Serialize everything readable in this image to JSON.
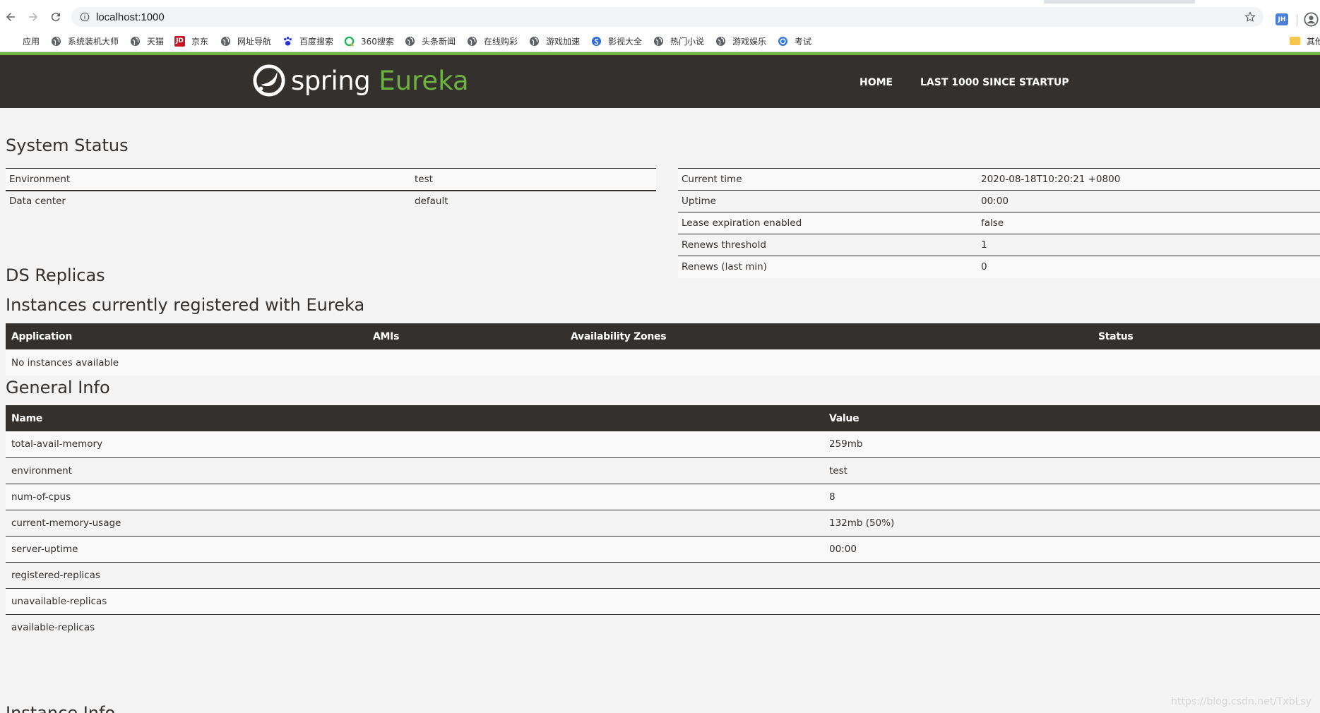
{
  "browser": {
    "url": "localhost:1000",
    "bookmarks": [
      {
        "label": "应用",
        "icon": "apps-grid-icon"
      },
      {
        "label": "系统装机大师",
        "icon": "globe-icon"
      },
      {
        "label": "天猫",
        "icon": "globe-icon"
      },
      {
        "label": "京东",
        "icon": "jd-icon"
      },
      {
        "label": "网址导航",
        "icon": "globe-icon"
      },
      {
        "label": "百度搜索",
        "icon": "baidu-paw-icon"
      },
      {
        "label": "360搜索",
        "icon": "360-search-icon"
      },
      {
        "label": "头条新闻",
        "icon": "globe-icon"
      },
      {
        "label": "在线购彩",
        "icon": "globe-icon"
      },
      {
        "label": "游戏加速",
        "icon": "globe-icon"
      },
      {
        "label": "影视大全",
        "icon": "sogou-icon"
      },
      {
        "label": "热门小说",
        "icon": "globe-icon"
      },
      {
        "label": "游戏娱乐",
        "icon": "globe-icon"
      },
      {
        "label": "考试",
        "icon": "exam-icon"
      }
    ],
    "other_bookmarks_label": "其他"
  },
  "nav": {
    "logo_spring": "spring",
    "logo_eureka": "Eureka",
    "home": "HOME",
    "last1000": "LAST 1000 SINCE STARTUP"
  },
  "system_status": {
    "title": "System Status",
    "left": [
      {
        "label": "Environment",
        "value": "test"
      },
      {
        "label": "Data center",
        "value": "default"
      }
    ],
    "right": [
      {
        "label": "Current time",
        "value": "2020-08-18T10:20:21 +0800"
      },
      {
        "label": "Uptime",
        "value": "00:00"
      },
      {
        "label": "Lease expiration enabled",
        "value": "false"
      },
      {
        "label": "Renews threshold",
        "value": "1"
      },
      {
        "label": "Renews (last min)",
        "value": "0"
      }
    ]
  },
  "ds_replicas": {
    "title": "DS Replicas"
  },
  "instances": {
    "title": "Instances currently registered with Eureka",
    "columns": [
      "Application",
      "AMIs",
      "Availability Zones",
      "Status"
    ],
    "empty_message": "No instances available"
  },
  "general_info": {
    "title": "General Info",
    "columns": [
      "Name",
      "Value"
    ],
    "rows": [
      {
        "name": "total-avail-memory",
        "value": "259mb"
      },
      {
        "name": "environment",
        "value": "test"
      },
      {
        "name": "num-of-cpus",
        "value": "8"
      },
      {
        "name": "current-memory-usage",
        "value": "132mb (50%)"
      },
      {
        "name": "server-uptime",
        "value": "00:00"
      },
      {
        "name": "registered-replicas",
        "value": ""
      },
      {
        "name": "unavailable-replicas",
        "value": ""
      },
      {
        "name": "available-replicas",
        "value": ""
      }
    ]
  },
  "next_section_title": "Instance Info",
  "watermark": "https://blog.csdn.net/TxbLsy",
  "colors": {
    "header_bg": "#34302d",
    "accent_green": "#6db33f",
    "page_bg": "#f4f4f4"
  }
}
